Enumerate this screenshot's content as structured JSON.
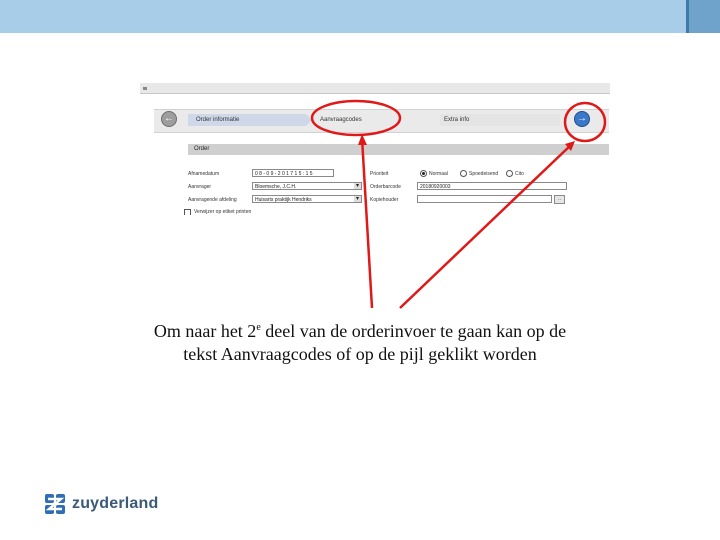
{
  "slide": {
    "caption_part1": "Om naar het 2",
    "caption_sup": "e",
    "caption_part2": " deel van de orderinvoer te gaan kan op de",
    "caption_line2": "tekst Aanvraagcodes of op de pijl geklikt worden",
    "logo_text": "zuyderland"
  },
  "colors": {
    "top_band": "#a7cde8",
    "annotation_red": "#e01818",
    "next_button_blue": "#3b78c9"
  },
  "screenshot": {
    "wizard": {
      "prev_icon": "arrow-left-icon",
      "next_icon": "arrow-right-icon",
      "steps": [
        "Order informatie",
        "Aanvraagcodes",
        "Extra info"
      ]
    },
    "section_title": "Order",
    "fields": {
      "afnamedatum_label": "Afnamedatum",
      "afnamedatum_value": "0 8 - 0 9 - 2 0 1 7   1 5 : 1 5",
      "aanvrager_label": "Aanvrager",
      "aanvrager_value": "Bloemsche, J.C.H.",
      "aanvragendeafdeling_label": "Aanvragende afdeling",
      "aanvragendeafdeling_value": "Huisarts praktijk Hendriks",
      "prioriteit_label": "Prioriteit",
      "prioriteit_options": [
        "Normaal",
        "Spoedeisend",
        "Cito"
      ],
      "orderbarcode_label": "Orderbarcode",
      "orderbarcode_value": "20180920003",
      "kopiehouder_label": "Kopiehouder",
      "kopiehouder_button": "..",
      "checkbox_label": "Verwijzer op etiket printen"
    }
  }
}
